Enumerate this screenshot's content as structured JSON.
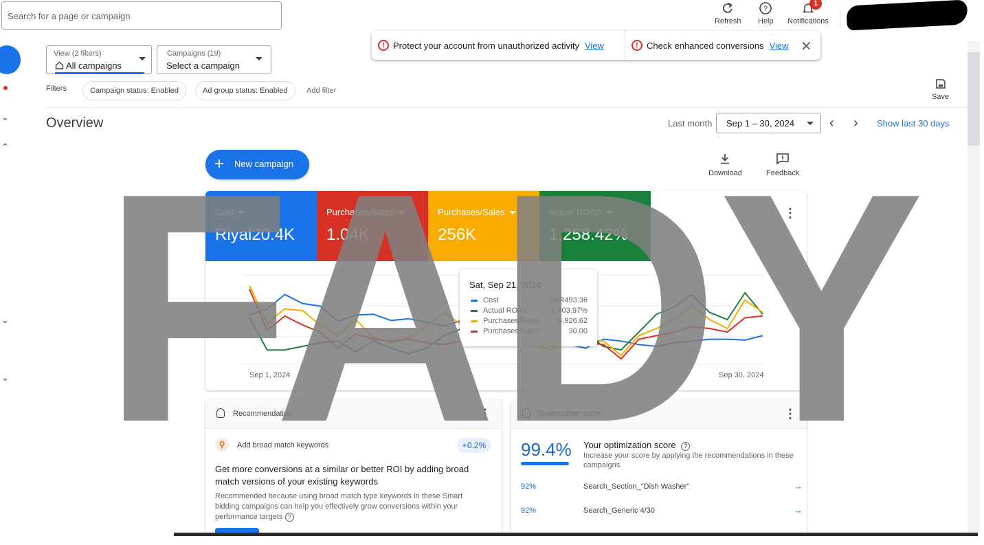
{
  "topbar": {
    "search_placeholder": "Search for a page or campaign",
    "refresh_label": "Refresh",
    "help_label": "Help",
    "notifications_label": "Notifications",
    "notifications_count": "1"
  },
  "alerts": [
    {
      "text": "Protect your account from unauthorized activity",
      "link": "View"
    },
    {
      "text": "Check enhanced conversions",
      "link": "View"
    }
  ],
  "selectors": {
    "view_small": "View (2 filters)",
    "view_value": "All campaigns",
    "campaigns_small": "Campaigns (19)",
    "campaigns_value": "Select a campaign"
  },
  "filters": {
    "label": "Filters",
    "chips": [
      "Campaign status: Enabled",
      "Ad group status: Enabled"
    ],
    "add_filter": "Add filter",
    "save_label": "Save"
  },
  "overview": {
    "title": "Overview",
    "period_label": "Last month",
    "date_range": "Sep 1 – 30, 2024",
    "show_last": "Show last 30 days",
    "new_campaign": "New campaign",
    "download": "Download",
    "feedback": "Feedback"
  },
  "metrics": [
    {
      "label": "Cost",
      "value": "Riyal20.4K",
      "color": "#1a73e8"
    },
    {
      "label": "Purchases/Sales",
      "value": "1.04K",
      "color": "#d93025"
    },
    {
      "label": "Purchases/Sales",
      "value": "256K",
      "color": "#f9ab00"
    },
    {
      "label": "Actual ROAS",
      "value": "1,258.42%",
      "color": "#188038"
    }
  ],
  "chart_data": {
    "type": "line",
    "x_start_label": "Sep 1, 2024",
    "x_end_label": "Sep 30, 2024",
    "series": [
      {
        "name": "Cost",
        "color": "#1a73e8",
        "values": [
          0.55,
          0.62,
          0.78,
          0.68,
          0.65,
          0.48,
          0.55,
          0.56,
          0.49,
          0.51,
          0.47,
          0.43,
          0.49,
          0.54,
          0.56,
          0.5,
          0.44,
          0.3,
          0.22,
          0.18,
          0.28,
          0.26,
          0.22,
          0.2,
          0.24,
          0.26,
          0.28,
          0.28,
          0.27,
          0.32
        ]
      },
      {
        "name": "Actual ROAS",
        "color": "#188038",
        "values": [
          0.52,
          0.16,
          0.16,
          0.2,
          0.24,
          0.26,
          0.14,
          0.26,
          0.18,
          0.12,
          0.18,
          0.32,
          0.4,
          0.34,
          0.26,
          0.28,
          0.34,
          0.36,
          0.3,
          0.34,
          0.2,
          0.16,
          0.36,
          0.56,
          0.64,
          0.78,
          0.58,
          0.5,
          0.8,
          0.56
        ]
      },
      {
        "name": "Purchases/Sales",
        "color": "#f9ab00",
        "values": [
          0.88,
          0.46,
          0.62,
          0.6,
          0.44,
          0.32,
          0.5,
          0.3,
          0.24,
          0.3,
          0.42,
          0.58,
          0.44,
          0.4,
          0.28,
          0.3,
          0.22,
          0.16,
          0.24,
          0.28,
          0.26,
          0.1,
          0.32,
          0.4,
          0.5,
          0.66,
          0.5,
          0.4,
          0.72,
          0.58
        ]
      },
      {
        "name": "Purchases/Sales",
        "color": "#d93025",
        "values": [
          0.84,
          0.38,
          0.54,
          0.44,
          0.36,
          0.18,
          0.34,
          0.28,
          0.26,
          0.28,
          0.24,
          0.22,
          0.26,
          0.22,
          0.22,
          0.26,
          0.24,
          0.2,
          0.22,
          0.24,
          0.22,
          0.06,
          0.28,
          0.32,
          0.36,
          0.42,
          0.4,
          0.36,
          0.52,
          0.54
        ]
      }
    ]
  },
  "tooltip": {
    "date": "Sat, Sep 21, 2024",
    "rows": [
      {
        "name": "Cost",
        "value": "SAR493.36"
      },
      {
        "name": "Actual ROAS",
        "value": "1,403.97%"
      },
      {
        "name": "Purchases/Sales",
        "value": "6,926.62"
      },
      {
        "name": "Purchases/Sales",
        "value": "30.00"
      }
    ]
  },
  "recommendation": {
    "title": "Recommendation",
    "chip_text": "Add broad match keywords",
    "badge": "+0.2%",
    "headline": "Get more conversions at a similar or better ROI by adding broad match versions of your existing keywords",
    "body": "Recommended because using broad match type keywords in these Smart bidding campaigns can help you effectively grow conversions within your performance targets"
  },
  "optimization": {
    "title": "Optimization score",
    "score": "99.4%",
    "score_title": "Your optimization score",
    "score_sub": "Increase your score by applying the recommendations in these campaigns",
    "rows": [
      {
        "pct": "92%",
        "name": "Search_Section_\"Dish Washer\""
      },
      {
        "pct": "92%",
        "name": "Search_Generic 4/30"
      }
    ]
  },
  "watermark": {
    "text": "FADY",
    "color": "#7f7f7f"
  }
}
